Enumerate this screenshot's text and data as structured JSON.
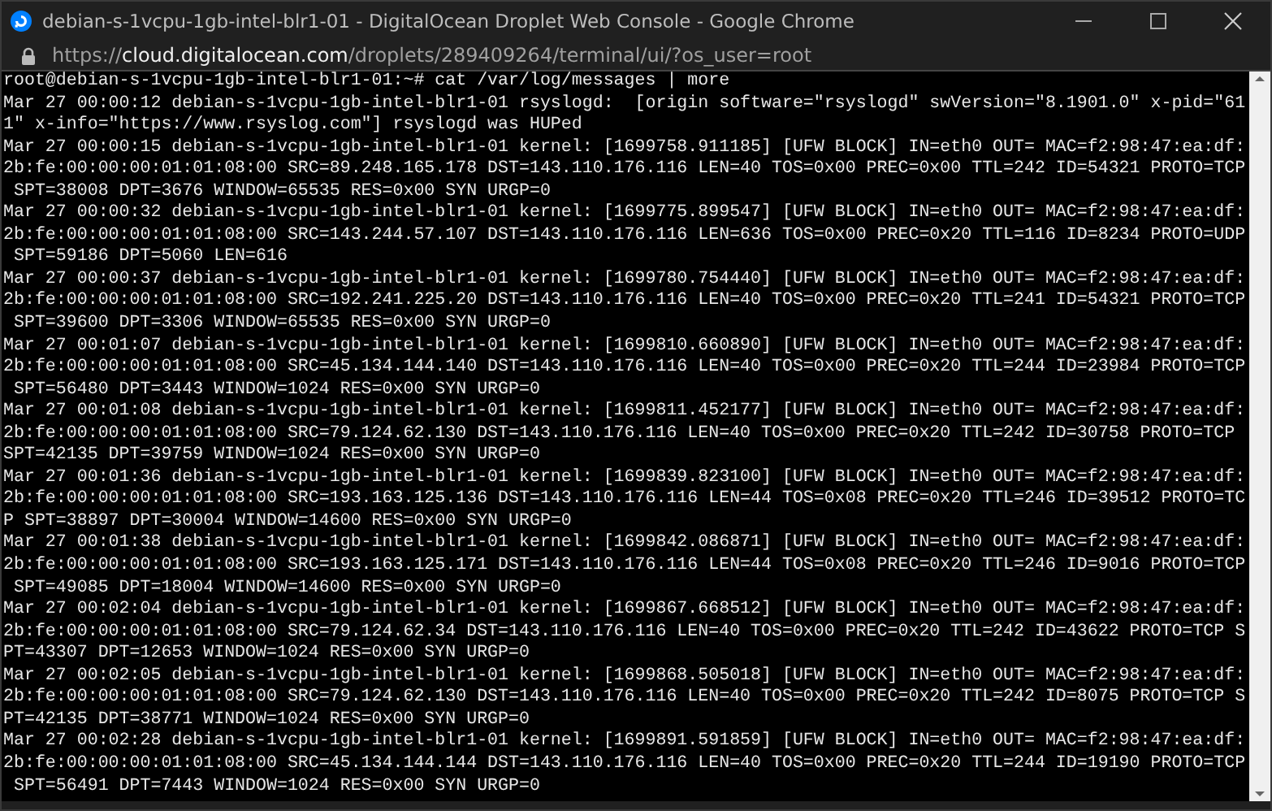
{
  "window": {
    "title": "debian-s-1vcpu-1gb-intel-blr1-01 - DigitalOcean Droplet Web Console - Google Chrome"
  },
  "address_bar": {
    "scheme": "https://",
    "host": "cloud.digitalocean.com",
    "path": "/droplets/289409264/terminal/ui/?os_user=root"
  },
  "terminal": {
    "lines": [
      "root@debian-s-1vcpu-1gb-intel-blr1-01:~# cat /var/log/messages | more",
      "Mar 27 00:00:12 debian-s-1vcpu-1gb-intel-blr1-01 rsyslogd:  [origin software=\"rsyslogd\" swVersion=\"8.1901.0\" x-pid=\"61",
      "1\" x-info=\"https://www.rsyslog.com\"] rsyslogd was HUPed",
      "Mar 27 00:00:15 debian-s-1vcpu-1gb-intel-blr1-01 kernel: [1699758.911185] [UFW BLOCK] IN=eth0 OUT= MAC=f2:98:47:ea:df:",
      "2b:fe:00:00:00:01:01:08:00 SRC=89.248.165.178 DST=143.110.176.116 LEN=40 TOS=0x00 PREC=0x00 TTL=242 ID=54321 PROTO=TCP",
      " SPT=38008 DPT=3676 WINDOW=65535 RES=0x00 SYN URGP=0",
      "Mar 27 00:00:32 debian-s-1vcpu-1gb-intel-blr1-01 kernel: [1699775.899547] [UFW BLOCK] IN=eth0 OUT= MAC=f2:98:47:ea:df:",
      "2b:fe:00:00:00:01:01:08:00 SRC=143.244.57.107 DST=143.110.176.116 LEN=636 TOS=0x00 PREC=0x20 TTL=116 ID=8234 PROTO=UDP",
      " SPT=59186 DPT=5060 LEN=616",
      "Mar 27 00:00:37 debian-s-1vcpu-1gb-intel-blr1-01 kernel: [1699780.754440] [UFW BLOCK] IN=eth0 OUT= MAC=f2:98:47:ea:df:",
      "2b:fe:00:00:00:01:01:08:00 SRC=192.241.225.20 DST=143.110.176.116 LEN=40 TOS=0x00 PREC=0x20 TTL=241 ID=54321 PROTO=TCP",
      " SPT=39600 DPT=3306 WINDOW=65535 RES=0x00 SYN URGP=0",
      "Mar 27 00:01:07 debian-s-1vcpu-1gb-intel-blr1-01 kernel: [1699810.660890] [UFW BLOCK] IN=eth0 OUT= MAC=f2:98:47:ea:df:",
      "2b:fe:00:00:00:01:01:08:00 SRC=45.134.144.140 DST=143.110.176.116 LEN=40 TOS=0x00 PREC=0x20 TTL=244 ID=23984 PROTO=TCP",
      " SPT=56480 DPT=3443 WINDOW=1024 RES=0x00 SYN URGP=0",
      "Mar 27 00:01:08 debian-s-1vcpu-1gb-intel-blr1-01 kernel: [1699811.452177] [UFW BLOCK] IN=eth0 OUT= MAC=f2:98:47:ea:df:",
      "2b:fe:00:00:00:01:01:08:00 SRC=79.124.62.130 DST=143.110.176.116 LEN=40 TOS=0x00 PREC=0x20 TTL=242 ID=30758 PROTO=TCP",
      "SPT=42135 DPT=39759 WINDOW=1024 RES=0x00 SYN URGP=0",
      "Mar 27 00:01:36 debian-s-1vcpu-1gb-intel-blr1-01 kernel: [1699839.823100] [UFW BLOCK] IN=eth0 OUT= MAC=f2:98:47:ea:df:",
      "2b:fe:00:00:00:01:01:08:00 SRC=193.163.125.136 DST=143.110.176.116 LEN=44 TOS=0x08 PREC=0x20 TTL=246 ID=39512 PROTO=TC",
      "P SPT=38897 DPT=30004 WINDOW=14600 RES=0x00 SYN URGP=0",
      "Mar 27 00:01:38 debian-s-1vcpu-1gb-intel-blr1-01 kernel: [1699842.086871] [UFW BLOCK] IN=eth0 OUT= MAC=f2:98:47:ea:df:",
      "2b:fe:00:00:00:01:01:08:00 SRC=193.163.125.171 DST=143.110.176.116 LEN=44 TOS=0x08 PREC=0x20 TTL=246 ID=9016 PROTO=TCP",
      " SPT=49085 DPT=18004 WINDOW=14600 RES=0x00 SYN URGP=0",
      "Mar 27 00:02:04 debian-s-1vcpu-1gb-intel-blr1-01 kernel: [1699867.668512] [UFW BLOCK] IN=eth0 OUT= MAC=f2:98:47:ea:df:",
      "2b:fe:00:00:00:01:01:08:00 SRC=79.124.62.34 DST=143.110.176.116 LEN=40 TOS=0x00 PREC=0x20 TTL=242 ID=43622 PROTO=TCP S",
      "PT=43307 DPT=12653 WINDOW=1024 RES=0x00 SYN URGP=0",
      "Mar 27 00:02:05 debian-s-1vcpu-1gb-intel-blr1-01 kernel: [1699868.505018] [UFW BLOCK] IN=eth0 OUT= MAC=f2:98:47:ea:df:",
      "2b:fe:00:00:00:01:01:08:00 SRC=79.124.62.130 DST=143.110.176.116 LEN=40 TOS=0x00 PREC=0x20 TTL=242 ID=8075 PROTO=TCP S",
      "PT=42135 DPT=38771 WINDOW=1024 RES=0x00 SYN URGP=0",
      "Mar 27 00:02:28 debian-s-1vcpu-1gb-intel-blr1-01 kernel: [1699891.591859] [UFW BLOCK] IN=eth0 OUT= MAC=f2:98:47:ea:df:",
      "2b:fe:00:00:00:01:01:08:00 SRC=45.134.144.144 DST=143.110.176.116 LEN=40 TOS=0x00 PREC=0x20 TTL=244 ID=19190 PROTO=TCP",
      " SPT=56491 DPT=7443 WINDOW=1024 RES=0x00 SYN URGP=0"
    ]
  }
}
